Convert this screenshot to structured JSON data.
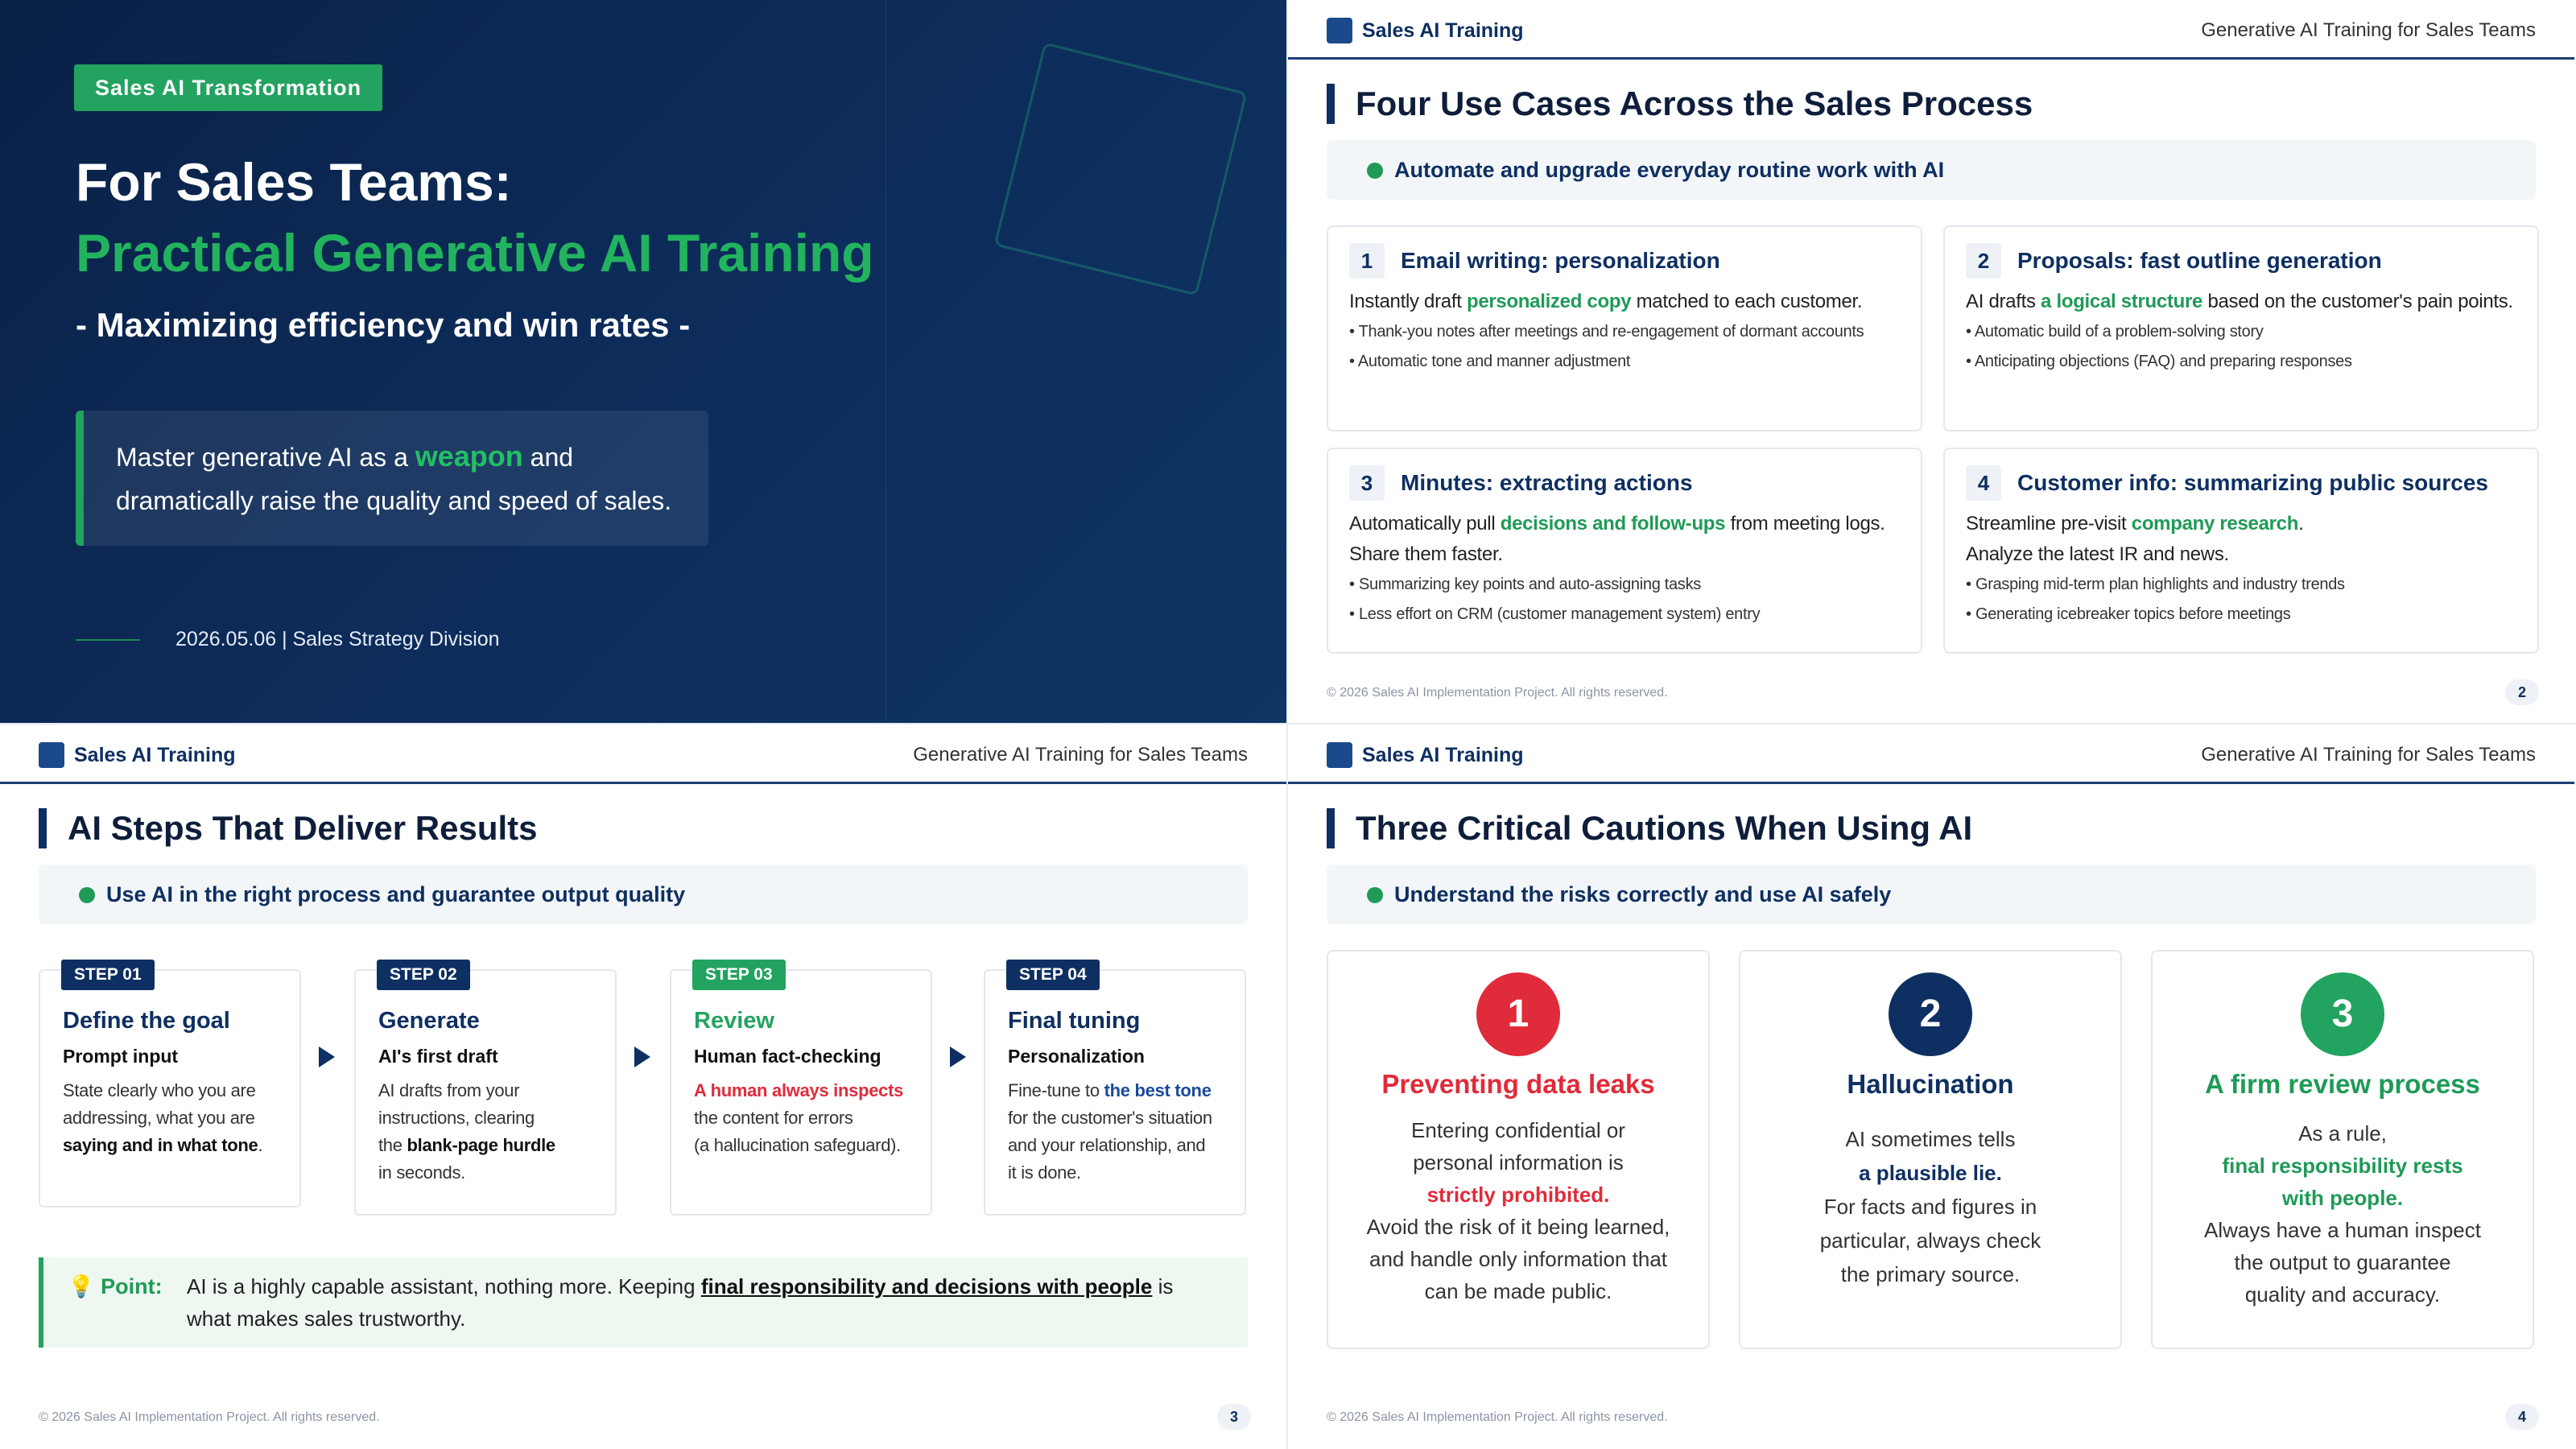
{
  "slide1": {
    "badge": "Sales AI Transformation",
    "title1": "For Sales Teams:",
    "title2": "Practical Generative AI Training",
    "subtitle": "- Maximizing efficiency and win rates -",
    "box_pre": "Master generative AI as a ",
    "box_hl": "weapon",
    "box_post": " and",
    "box_line2": "dramatically raise the quality and speed of sales.",
    "footer": "2026.05.06 | Sales Strategy Division",
    "colors": {
      "accent": "#22a35f",
      "navy": "#0a2147"
    }
  },
  "header": {
    "brand": "Sales AI Training",
    "right": "Generative AI Training for Sales Teams"
  },
  "copyright": "© 2026 Sales AI Implementation Project. All rights reserved.",
  "slide2": {
    "title": "Four Use Cases Across the Sales Process",
    "subbar": "Automate and upgrade everyday routine work with AI",
    "page": "2",
    "cards": [
      {
        "num": "1",
        "title": "Email writing: personalization",
        "d1a": "Instantly draft ",
        "d1g": "personalized copy",
        "d1b": " matched to each customer.",
        "d2": "",
        "b1": "• Thank-you notes after meetings and re-engagement of dormant accounts",
        "b2": "• Automatic tone and manner adjustment"
      },
      {
        "num": "2",
        "title": "Proposals: fast outline generation",
        "d1a": "AI drafts ",
        "d1g": "a logical structure",
        "d1b": " based on the customer's pain points.",
        "d2": "",
        "b1": "• Automatic build of a problem-solving story",
        "b2": "• Anticipating objections (FAQ) and preparing responses"
      },
      {
        "num": "3",
        "title": "Minutes: extracting actions",
        "d1a": "Automatically pull ",
        "d1g": "decisions and follow-ups",
        "d1b": " from meeting logs.",
        "d2": "Share them faster.",
        "b1": "• Summarizing key points and auto-assigning tasks",
        "b2": "• Less effort on CRM (customer management system) entry"
      },
      {
        "num": "4",
        "title": "Customer info: summarizing public sources",
        "d1a": "Streamline pre-visit ",
        "d1g": "company research",
        "d1b": ".",
        "d2": "Analyze the latest IR and news.",
        "b1": "• Grasping mid-term plan highlights and industry trends",
        "b2": "• Generating icebreaker topics before meetings"
      }
    ]
  },
  "slide3": {
    "title": "AI Steps That Deliver Results",
    "subbar": "Use AI in the right process and guarantee output quality",
    "page": "3",
    "steps": [
      {
        "tag": "STEP 01",
        "title": "Define the goal",
        "sub": "Prompt input",
        "l1": "State clearly who you are",
        "l2": "addressing, what you are",
        "l3b": "saying and in what tone",
        "l3c": ".",
        "l4": ""
      },
      {
        "tag": "STEP 02",
        "title": "Generate",
        "sub": "AI's first draft",
        "l1": "AI drafts from your",
        "l2": "instructions, clearing",
        "l3a": "the ",
        "l3b": "blank-page hurdle",
        "l4": "in seconds."
      },
      {
        "tag": "STEP 03",
        "title": "Review",
        "sub": "Human fact-checking",
        "l1": "A human always inspects",
        "l2": "the content for errors",
        "l3": "(a hallucination safeguard)."
      },
      {
        "tag": "STEP 04",
        "title": "Final tuning",
        "sub": "Personalization",
        "l1a": "Fine-tune to ",
        "l1b": "the best tone",
        "l2": "for the customer's situation",
        "l3": "and your relationship, and",
        "l4": "it is done."
      }
    ],
    "point_label": "Point:",
    "point_pre": "AI is a highly capable assistant, nothing more. Keeping ",
    "point_u": "final responsibility and decisions with people",
    "point_post": " is",
    "point_line2": "what makes sales trustworthy."
  },
  "slide4": {
    "title": "Three Critical Cautions When Using AI",
    "subbar": "Understand the risks correctly and use AI safely",
    "page": "4",
    "cards": [
      {
        "num": "1",
        "title": "Preventing data leaks",
        "color": "#e02b3a",
        "l1": "Entering confidential or",
        "l2": "personal information is",
        "l3": "strictly prohibited.",
        "l4": "Avoid the risk of it being learned,",
        "l5": "and handle only information that",
        "l6": "can be made public."
      },
      {
        "num": "2",
        "title": "Hallucination",
        "color": "#0e2f61",
        "l1": "AI sometimes tells",
        "l2": "a plausible lie.",
        "l3": "For facts and figures in",
        "l4": "particular, always check",
        "l5": "the primary source."
      },
      {
        "num": "3",
        "title": "A firm review process",
        "color": "#1f9a57",
        "l1": "As a rule,",
        "l2": "final responsibility rests",
        "l3": "with people.",
        "l4": "Always have a human inspect",
        "l5": "the output to guarantee",
        "l6": "quality and accuracy."
      }
    ]
  }
}
